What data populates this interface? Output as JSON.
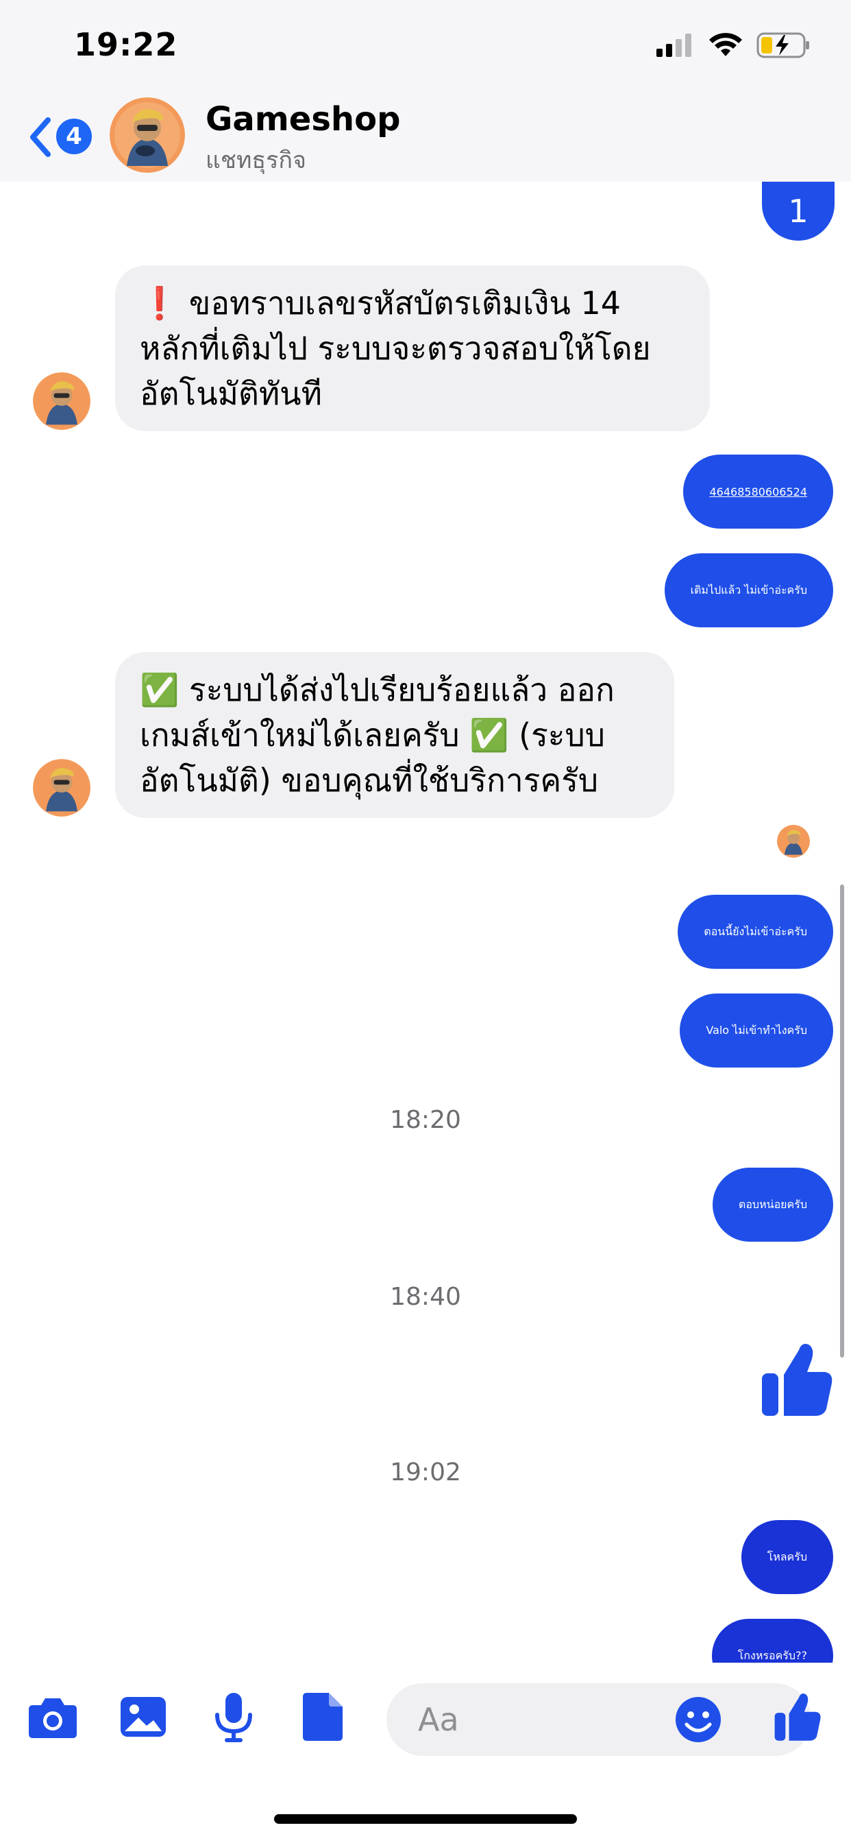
{
  "status_bar": {
    "time": "19:22"
  },
  "header": {
    "back_badge": "4",
    "title": "Gameshop",
    "subtitle": "แชทธุรกิจ"
  },
  "messages": {
    "m1": "1",
    "m2": "❗ ขอทราบเลขรหัสบัตรเติมเงิน 14 หลักที่เติมไป ระบบจะตรวจสอบให้โดยอัตโนมัติทันที",
    "m3": "46468580606524",
    "m4": "เติมไปแล้ว ไม่เข้าอ่ะครับ",
    "m5": "✅ ระบบได้ส่งไปเรียบร้อยแล้ว ออกเกมส์เข้าใหม่ได้เลยครับ ✅ (ระบบอัตโนมัติ) ขอบคุณที่ใช้บริการครับ",
    "m6": "ตอนนี้ยังไม่เข้าอ่ะครับ",
    "m7": "Valo ไม่เข้าทำไงครับ",
    "ts1": "18:20",
    "m8": "ตอบหน่อยครับ",
    "ts2": "18:40",
    "ts3": "19:02",
    "m9": "โหลครับ",
    "m10": "โกงหรอครับ??"
  },
  "composer": {
    "placeholder": "Aa"
  },
  "icons": {
    "camera": "camera-icon",
    "gallery": "gallery-icon",
    "mic": "microphone-icon",
    "file": "file-icon",
    "emoji": "emoji-icon",
    "like": "thumbs-up-icon"
  },
  "colors": {
    "accent": "#1f4fe8",
    "accent_dark": "#1a33d6",
    "incoming_bubble": "#f0f0f2",
    "avatar_bg": "#f39a5a"
  }
}
